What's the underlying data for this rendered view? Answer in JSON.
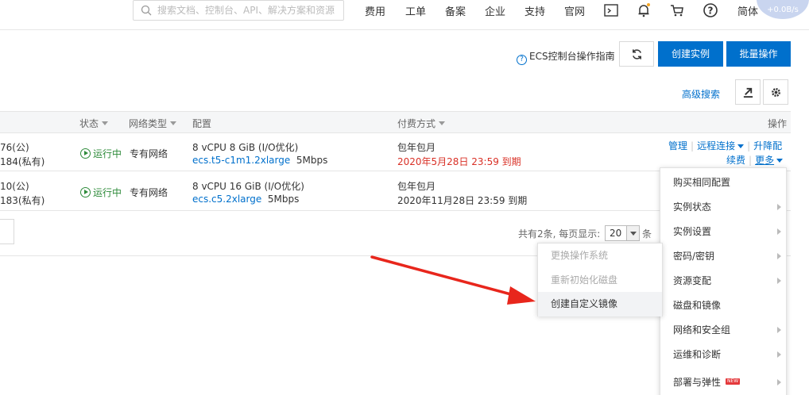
{
  "topnav": {
    "search_placeholder": "搜索文档、控制台、API、解决方案和资源",
    "links": [
      "费用",
      "工单",
      "备案",
      "企业",
      "支持",
      "官网"
    ],
    "lang": "简体",
    "avatar_text": "+0.0B/s"
  },
  "toolbar": {
    "guide_label": "ECS控制台操作指南",
    "create_label": "创建实例",
    "batch_label": "批量操作",
    "advanced_search": "高级搜索"
  },
  "table": {
    "headers": {
      "status": "状态",
      "network": "网络类型",
      "config": "配置",
      "billing": "付费方式",
      "actions": "操作"
    },
    "rows": [
      {
        "ip_public": "76(公)",
        "ip_private": "184(私有)",
        "status": "运行中",
        "network": "专有网络",
        "spec": "8 vCPU 8 GiB (I/O优化)",
        "type": "ecs.t5-c1m1.2xlarge",
        "bandwidth": "5Mbps",
        "billing": "包年包月",
        "expire": "2020年5月28日 23:59 到期",
        "actions": {
          "manage": "管理",
          "remote": "远程连接",
          "upgrade": "升降配",
          "renew": "续费",
          "more": "更多"
        }
      },
      {
        "ip_public": "10(公)",
        "ip_private": "183(私有)",
        "status": "运行中",
        "network": "专有网络",
        "spec": "8 vCPU 16 GiB (I/O优化)",
        "type": "ecs.c5.2xlarge",
        "bandwidth": "5Mbps",
        "billing": "包年包月",
        "expire": "2020年11月28日 23:59 到期"
      }
    ]
  },
  "pagination": {
    "summary": "共有2条, 每页显示:",
    "page_size": "20",
    "unit": "条"
  },
  "more_menu": {
    "items": [
      "购买相同配置",
      "实例状态",
      "实例设置",
      "密码/密钥",
      "资源变配",
      "磁盘和镜像",
      "网络和安全组",
      "运维和诊断",
      "部署与弹性"
    ],
    "new_tag": "NEW"
  },
  "submenu": {
    "items": [
      "更换操作系统",
      "重新初始化磁盘",
      "创建自定义镜像"
    ]
  },
  "colors": {
    "primary": "#0070cc",
    "running": "#2e8b3a",
    "expire_warning": "#d93026",
    "arrow": "#e8261c"
  }
}
